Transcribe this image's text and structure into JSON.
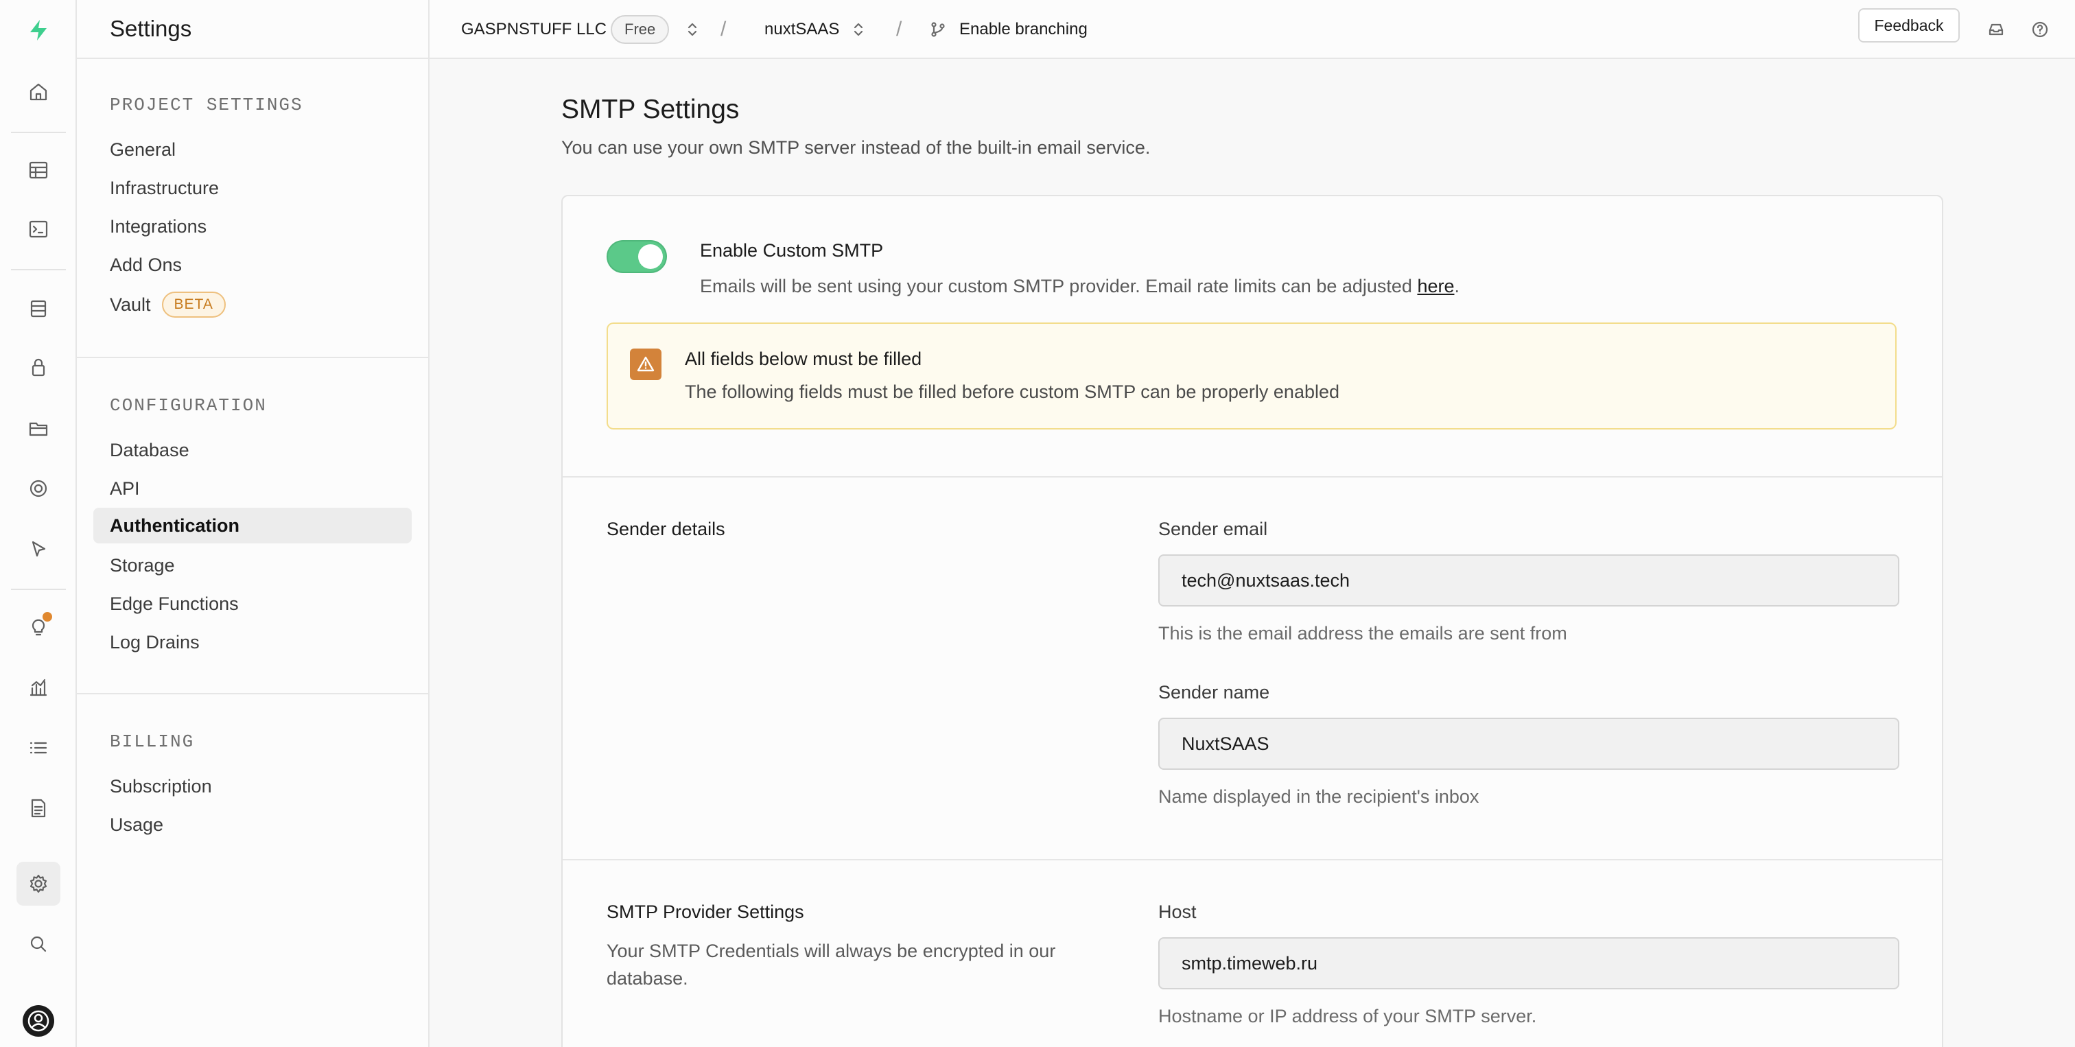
{
  "rail": {
    "icons": [
      "supabase-logo-icon",
      "home-icon",
      "table-editor-icon",
      "sql-editor-icon",
      "database-icon",
      "auth-icon",
      "storage-icon",
      "realtime-icon",
      "edge-functions-icon",
      "advisors-icon",
      "reports-icon",
      "logs-icon",
      "api-docs-icon",
      "settings-icon",
      "search-icon",
      "user-avatar-icon"
    ],
    "accent": "#3ecf8e"
  },
  "sidebar": {
    "title": "Settings",
    "sections": [
      {
        "title": "PROJECT SETTINGS",
        "items": [
          "General",
          "Infrastructure",
          "Integrations",
          "Add Ons",
          "Vault"
        ]
      },
      {
        "title": "CONFIGURATION",
        "items": [
          "Database",
          "API",
          "Authentication",
          "Storage",
          "Edge Functions",
          "Log Drains"
        ]
      },
      {
        "title": "BILLING",
        "items": [
          "Subscription",
          "Usage"
        ]
      }
    ],
    "vault_badge": "BETA",
    "active_item": "Authentication"
  },
  "topbar": {
    "org": "GASPNSTUFF LLC",
    "plan": "Free",
    "separator": "/",
    "project": "nuxtSAAS",
    "branch": "Enable branching",
    "feedback": "Feedback"
  },
  "main": {
    "title": "SMTP Settings",
    "subtitle": "You can use your own SMTP server instead of the built-in email service.",
    "toggle": {
      "label": "Enable Custom SMTP",
      "on": true,
      "desc": "Emails will be sent using your custom SMTP provider. Email rate limits can be adjusted ",
      "link": "here",
      "desc_end": "."
    },
    "warning": {
      "title": "All fields below must be filled",
      "text": "The following fields must be filled before custom SMTP can be properly enabled"
    },
    "sender": {
      "section": "Sender details",
      "email_label": "Sender email",
      "email_value": "tech@nuxtsaas.tech",
      "email_help": "This is the email address the emails are sent from",
      "name_label": "Sender name",
      "name_value": "NuxtSAAS",
      "name_help": "Name displayed in the recipient's inbox"
    },
    "provider": {
      "section": "SMTP Provider Settings",
      "desc": "Your SMTP Credentials will always be encrypted in our database.",
      "host_label": "Host",
      "host_value": "smtp.timeweb.ru",
      "host_help": "Hostname or IP address of your SMTP server."
    }
  }
}
